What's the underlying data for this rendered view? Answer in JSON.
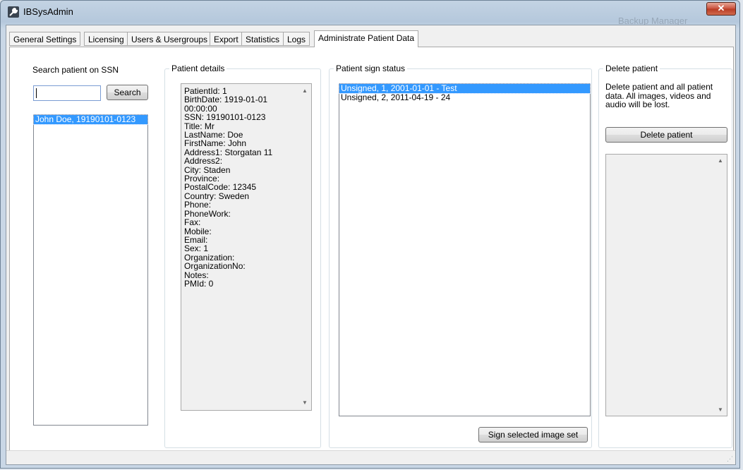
{
  "window": {
    "title": "IBSysAdmin",
    "background_app_title": "Backup Manager",
    "close_glyph": "✕"
  },
  "tabs": [
    {
      "label": "General Settings",
      "active": false
    },
    {
      "label": "Licensing",
      "active": false
    },
    {
      "label": "Users & Usergroups",
      "active": false
    },
    {
      "label": "Export",
      "active": false
    },
    {
      "label": "Statistics",
      "active": false
    },
    {
      "label": "Logs",
      "active": false
    },
    {
      "label": "Administrate Patient Data",
      "active": true
    }
  ],
  "search": {
    "label": "Search patient on SSN",
    "input_value": "",
    "button_label": "Search",
    "results": [
      "John Doe, 19190101-0123"
    ]
  },
  "patient_details": {
    "title": "Patient details",
    "lines": [
      "PatientId: 1",
      "BirthDate: 1919-01-01",
      "00:00:00",
      "SSN: 19190101-0123",
      "Title: Mr",
      "LastName: Doe",
      "FirstName: John",
      "Address1: Storgatan 11",
      "Address2:",
      "City: Staden",
      "Province:",
      "PostalCode: 12345",
      "Country: Sweden",
      "Phone:",
      "PhoneWork:",
      "Fax:",
      "Mobile:",
      "Email:",
      "Sex: 1",
      "Organization:",
      "OrganizationNo:",
      "Notes:",
      "PMId: 0"
    ]
  },
  "sign_status": {
    "title": "Patient sign status",
    "items": [
      {
        "text": "Unsigned, 1, 2001-01-01 - Test",
        "selected": true
      },
      {
        "text": "Unsigned, 2, 2011-04-19 - 24",
        "selected": false
      }
    ],
    "button_label": "Sign selected image set"
  },
  "delete": {
    "title": "Delete patient",
    "description": "Delete patient and all patient data. All images, videos and audio will be lost.",
    "button_label": "Delete patient"
  },
  "colors": {
    "selection": "#3399ff",
    "tab_page_bg": "#ffffff",
    "window_frame": "#b5c8dc"
  }
}
